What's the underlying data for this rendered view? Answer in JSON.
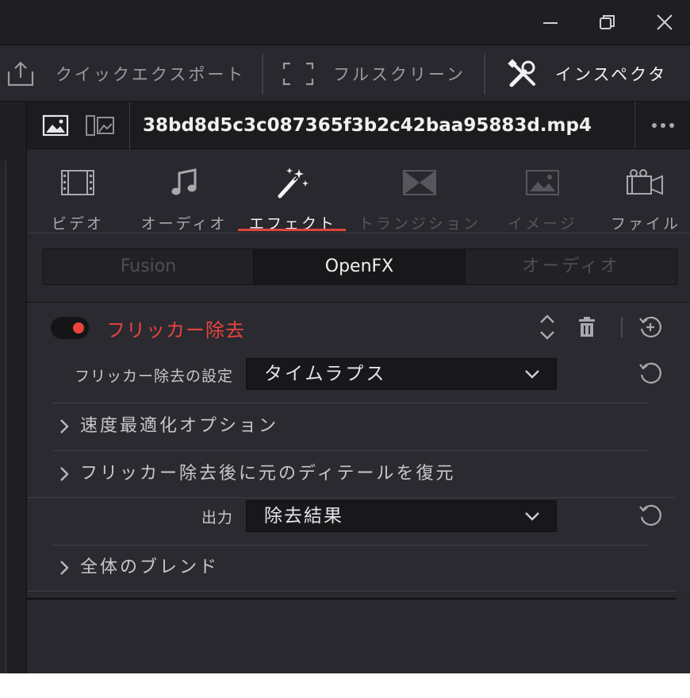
{
  "window": {
    "minimize_icon": "minimize-icon",
    "restore_icon": "restore-icon",
    "close_icon": "close-icon"
  },
  "toolbar": {
    "quick_export": "クイックエクスポート",
    "fullscreen": "フルスクリーン",
    "inspector": "インスペクタ"
  },
  "file": {
    "name": "38bd8d5c3c087365f3b2c42baa95883d.mp4"
  },
  "tabs": [
    {
      "label": "ビデオ",
      "icon": "film-icon",
      "state": "normal"
    },
    {
      "label": "オーディオ",
      "icon": "music-note-icon",
      "state": "normal"
    },
    {
      "label": "エフェクト",
      "icon": "magic-wand-icon",
      "state": "active"
    },
    {
      "label": "トランジション",
      "icon": "transition-icon",
      "state": "disabled"
    },
    {
      "label": "イメージ",
      "icon": "image-icon",
      "state": "disabled"
    },
    {
      "label": "ファイル",
      "icon": "camera-icon",
      "state": "normal"
    }
  ],
  "segments": [
    {
      "label": "Fusion",
      "active": false
    },
    {
      "label": "OpenFX",
      "active": true
    },
    {
      "label": "オーディオ",
      "active": false
    }
  ],
  "effect": {
    "title": "フリッカー除去",
    "enabled": true,
    "accent_color": "#e8443c",
    "setting_label": "フリッカー除去の設定",
    "setting_value": "タイムラプス",
    "section_speed": "速度最適化オプション",
    "section_restore": "フリッカー除去後に元のディテールを復元",
    "output_label": "出力",
    "output_value": "除去結果",
    "section_blend": "全体のブレンド"
  }
}
